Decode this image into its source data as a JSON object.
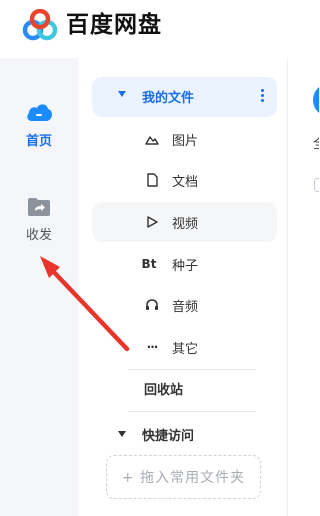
{
  "app": {
    "brand": "百度网盘"
  },
  "rail": {
    "home_label": "首页",
    "share_label": "收发",
    "accent": "#1a6fe6"
  },
  "nav": {
    "my_files": "我的文件",
    "items": [
      {
        "label": "图片",
        "icon": "image-icon"
      },
      {
        "label": "文档",
        "icon": "document-icon"
      },
      {
        "label": "视频",
        "icon": "play-icon"
      },
      {
        "label": "种子",
        "icon": "bt-icon",
        "glyph": "Bt"
      },
      {
        "label": "音频",
        "icon": "headphones-icon"
      },
      {
        "label": "其它",
        "icon": "more-icon",
        "glyph": "···"
      }
    ],
    "recycle": "回收站",
    "quick_access": "快捷访问",
    "drag_hint": "+ 拖入常用文件夹"
  },
  "main": {
    "partial_label": "全"
  },
  "annotation": {
    "arrow_color": "#e8352b"
  }
}
